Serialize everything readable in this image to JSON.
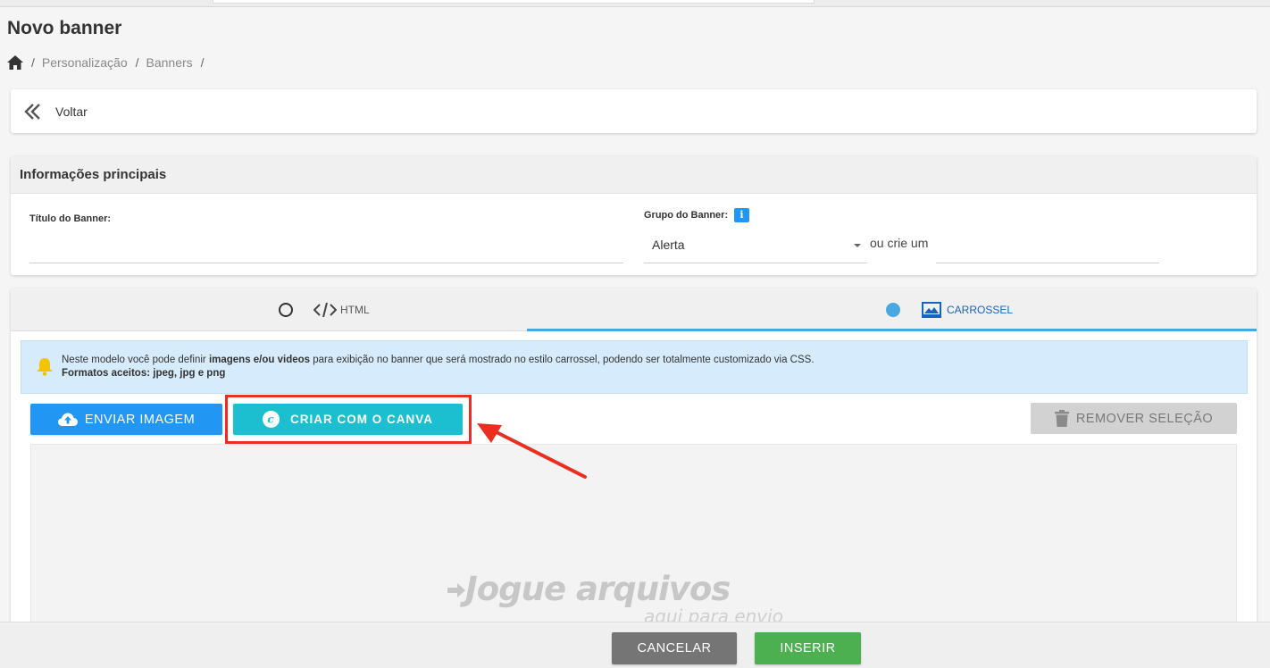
{
  "page": {
    "title": "Novo banner"
  },
  "breadcrumb": {
    "items": [
      "Personalização",
      "Banners"
    ]
  },
  "back": {
    "label": "Voltar"
  },
  "info": {
    "header": "Informações principais",
    "titulo_label": "Título do Banner:",
    "titulo_value": "",
    "grupo_label": "Grupo do Banner:",
    "grupo_value": "Alerta",
    "ou_crie": "ou crie um",
    "novo_grupo_value": ""
  },
  "tabs": [
    {
      "label": "HTML",
      "selected": false,
      "icon": "code-icon"
    },
    {
      "label": "CARROSSEL",
      "selected": true,
      "icon": "images-icon"
    }
  ],
  "alert": {
    "prefix": "Neste modelo você pode definir ",
    "bold": "imagens e/ou videos",
    "suffix": " para exibição no banner que será mostrado no estilo carrossel, podendo ser totalmente customizado via CSS.",
    "formats": "Formatos aceitos: jpeg, jpg e png"
  },
  "buttons": {
    "enviar": "ENVIAR IMAGEM",
    "canva": "CRIAR COM O CANVA",
    "remover": "REMOVER SELEÇÃO"
  },
  "dropzone": {
    "main": "Jogue arquivos",
    "sub": "aqui para envio"
  },
  "footer": {
    "cancel": "CANCELAR",
    "insert": "INSERIR"
  },
  "colors": {
    "primary": "#2196f3",
    "canva": "#1bbfcf",
    "accent_tab": "#4aa8e0",
    "highlight": "#ea2f20",
    "insert": "#4caf50",
    "cancel": "#757575"
  }
}
